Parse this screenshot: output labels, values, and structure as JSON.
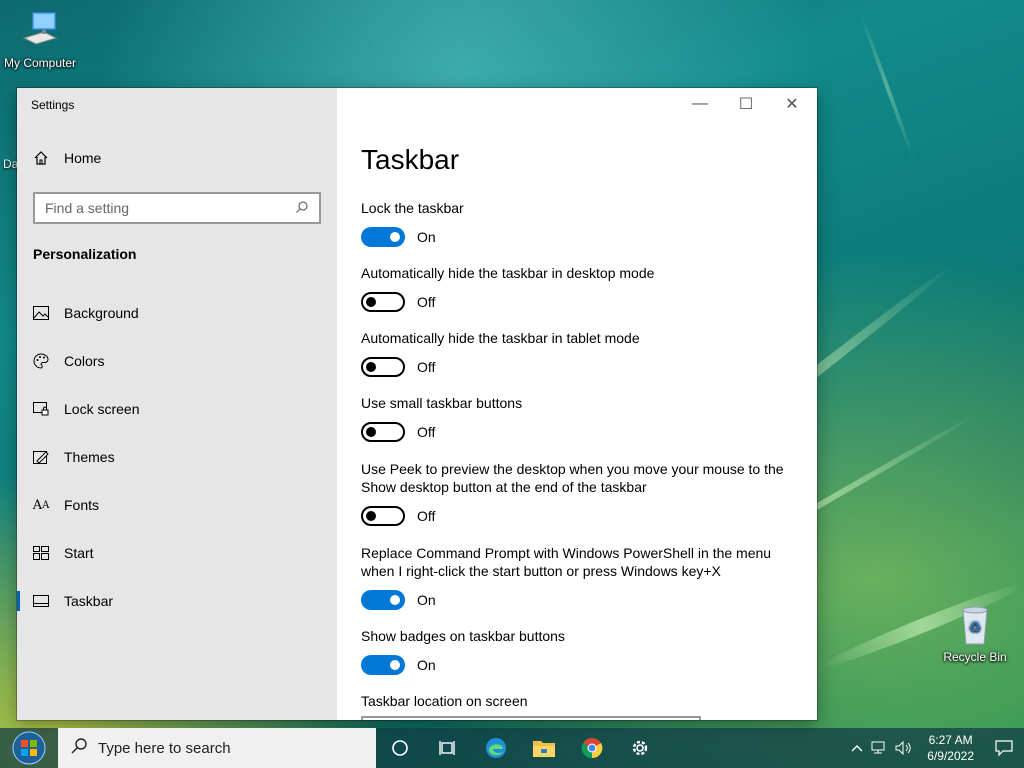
{
  "desktop": {
    "icons": [
      {
        "label": "My Computer",
        "icon": "computer-icon"
      },
      {
        "label": "Recycle Bin",
        "icon": "recycle-bin-icon"
      }
    ],
    "partial_label": "Da"
  },
  "window": {
    "app_title": "Settings",
    "controls": {
      "minimize": "—",
      "maximize": "☐",
      "close": "✕"
    }
  },
  "sidebar": {
    "home_label": "Home",
    "search_placeholder": "Find a setting",
    "section_title": "Personalization",
    "items": [
      {
        "label": "Background",
        "icon": "background-icon"
      },
      {
        "label": "Colors",
        "icon": "palette-icon"
      },
      {
        "label": "Lock screen",
        "icon": "lock-screen-icon"
      },
      {
        "label": "Themes",
        "icon": "themes-icon"
      },
      {
        "label": "Fonts",
        "icon": "fonts-icon"
      },
      {
        "label": "Start",
        "icon": "start-icon"
      },
      {
        "label": "Taskbar",
        "icon": "taskbar-icon",
        "active": true
      }
    ]
  },
  "main": {
    "title": "Taskbar",
    "settings": [
      {
        "label": "Lock the taskbar",
        "state": "On"
      },
      {
        "label": "Automatically hide the taskbar in desktop mode",
        "state": "Off"
      },
      {
        "label": "Automatically hide the taskbar in tablet mode",
        "state": "Off"
      },
      {
        "label": "Use small taskbar buttons",
        "state": "Off"
      },
      {
        "label": "Use Peek to preview the desktop when you move your mouse to the Show desktop button at the end of the taskbar",
        "state": "Off"
      },
      {
        "label": "Replace Command Prompt with Windows PowerShell in the menu when I right-click the start button or press Windows key+X",
        "state": "On"
      },
      {
        "label": "Show badges on taskbar buttons",
        "state": "On"
      }
    ],
    "location_label": "Taskbar location on screen"
  },
  "taskbar": {
    "search_placeholder": "Type here to search",
    "apps": [
      "cortana-icon",
      "task-view-icon",
      "edge-icon",
      "file-explorer-icon",
      "chrome-icon",
      "settings-gear-icon"
    ],
    "clock_time": "6:27 AM",
    "clock_date": "6/9/2022"
  },
  "colors": {
    "accent": "#0078d7",
    "sidebar_bg": "#e6e6e6",
    "active_bar": "#0063b1"
  }
}
